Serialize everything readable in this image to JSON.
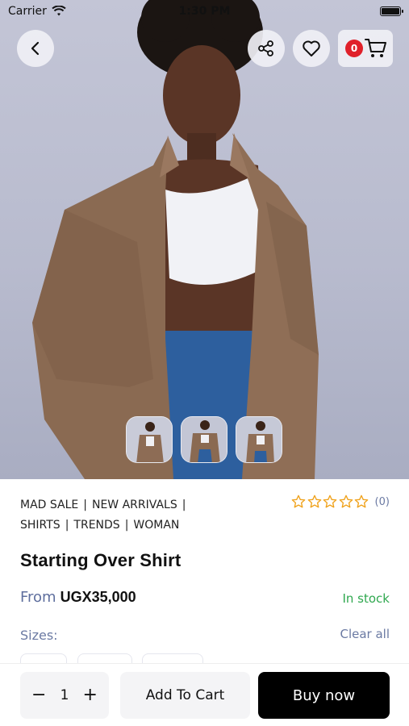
{
  "status_bar": {
    "carrier": "Carrier",
    "time": "1:30 PM"
  },
  "header": {
    "back_icon": "chevron-left-icon",
    "share_icon": "share-icon",
    "wishlist_icon": "heart-icon",
    "cart_icon": "cart-icon",
    "cart_count": "0"
  },
  "gallery": {
    "thumbnail_count": 3
  },
  "product": {
    "categories": [
      "MAD SALE",
      "NEW ARRIVALS",
      "SHIRTS",
      "TRENDS",
      "WOMAN"
    ],
    "category_separator": "|",
    "rating_count": "(0)",
    "rating_value": 0,
    "rating_max": 5,
    "title": "Starting Over Shirt",
    "price_prefix": "From",
    "price": "UGX35,000",
    "stock_status": "In stock",
    "sizes_label": "Sizes:",
    "clear_all_label": "Clear all"
  },
  "bottom_bar": {
    "quantity": "1",
    "decrement": "−",
    "increment": "+",
    "add_to_cart_label": "Add To Cart",
    "buy_now_label": "Buy now"
  },
  "colors": {
    "accent_dark": "#000000",
    "stock_green": "#2fa84f",
    "muted_blue": "#6b7aa3",
    "star_orange": "#f0a21b",
    "badge_red": "#e0202a"
  }
}
